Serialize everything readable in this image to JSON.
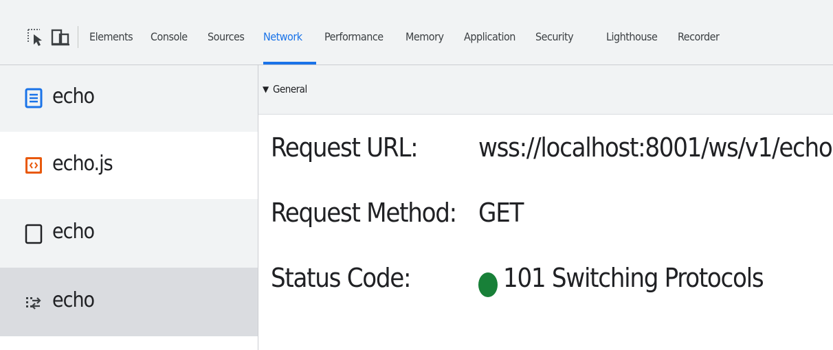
{
  "toolbar": {
    "tabs": [
      {
        "label": "Elements"
      },
      {
        "label": "Console"
      },
      {
        "label": "Sources"
      },
      {
        "label": "Network",
        "active": true
      },
      {
        "label": "Performance"
      },
      {
        "label": "Memory"
      },
      {
        "label": "Application"
      },
      {
        "label": "Security"
      },
      {
        "label": "Lighthouse"
      },
      {
        "label": "Recorder"
      }
    ],
    "icons": [
      "inspect-element-icon",
      "device-toolbar-icon"
    ]
  },
  "requests": [
    {
      "name": "echo",
      "icon": "document-icon"
    },
    {
      "name": "echo.js",
      "icon": "script-icon"
    },
    {
      "name": "echo",
      "icon": "blank-file-icon"
    },
    {
      "name": "echo",
      "icon": "websocket-icon",
      "selected": true
    }
  ],
  "details": {
    "section_title": "General",
    "rows": [
      {
        "key": "Request URL:",
        "value": "wss://localhost:8001/ws/v1/echo"
      },
      {
        "key": "Request Method:",
        "value": "GET"
      },
      {
        "key": "Status Code:",
        "value": "101 Switching Protocols"
      }
    ]
  },
  "colors": {
    "accent": "#1a73e8",
    "status_ok": "#188038",
    "selected_row": "#dadce0",
    "hover_row": "#f1f3f4",
    "toolbar_bg": "#f1f3f4"
  }
}
